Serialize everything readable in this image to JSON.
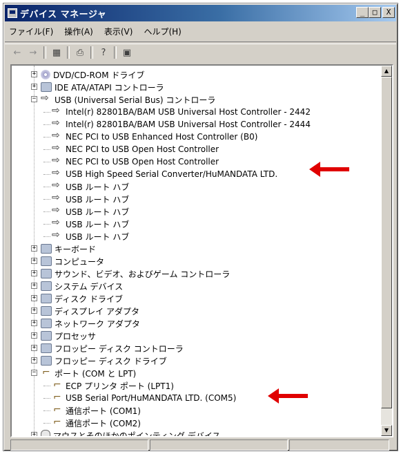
{
  "window": {
    "title": "デバイス マネージャ"
  },
  "window_buttons": {
    "minimize": "_",
    "maximize": "□",
    "close": "X"
  },
  "menu": [
    "ファイル(F)",
    "操作(A)",
    "表示(V)",
    "ヘルプ(H)"
  ],
  "toolbar": {
    "back": "←",
    "forward": "→",
    "view": "▦",
    "print": "⎙",
    "help": "?",
    "properties": "▣"
  },
  "tree": [
    {
      "label": "DVD/CD-ROM ドライブ",
      "level": 1,
      "expander": "+",
      "icon": "dvd-icon"
    },
    {
      "label": "IDE ATA/ATAPI コントローラ",
      "level": 1,
      "expander": "+",
      "icon": "ide-controller-icon"
    },
    {
      "label": "USB (Universal Serial Bus) コントローラ",
      "level": 1,
      "expander": "−",
      "icon": "usb-icon"
    },
    {
      "label": "Intel(r) 82801BA/BAM USB Universal Host Controller - 2442",
      "level": 2,
      "icon": "usb-icon"
    },
    {
      "label": "Intel(r) 82801BA/BAM USB Universal Host Controller - 2444",
      "level": 2,
      "icon": "usb-icon"
    },
    {
      "label": "NEC PCI to USB Enhanced Host Controller (B0)",
      "level": 2,
      "icon": "usb-icon"
    },
    {
      "label": "NEC PCI to USB Open Host Controller",
      "level": 2,
      "icon": "usb-icon"
    },
    {
      "label": "NEC PCI to USB Open Host Controller",
      "level": 2,
      "icon": "usb-icon"
    },
    {
      "label": "USB High Speed Serial Converter/HuMANDATA LTD.",
      "level": 2,
      "icon": "usb-icon"
    },
    {
      "label": "USB ルート ハブ",
      "level": 2,
      "icon": "usb-icon"
    },
    {
      "label": "USB ルート ハブ",
      "level": 2,
      "icon": "usb-icon"
    },
    {
      "label": "USB ルート ハブ",
      "level": 2,
      "icon": "usb-icon"
    },
    {
      "label": "USB ルート ハブ",
      "level": 2,
      "icon": "usb-icon"
    },
    {
      "label": "USB ルート ハブ",
      "level": 2,
      "icon": "usb-icon"
    },
    {
      "label": "キーボード",
      "level": 1,
      "expander": "+",
      "icon": "keyboard-icon"
    },
    {
      "label": "コンピュータ",
      "level": 1,
      "expander": "+",
      "icon": "computer-icon"
    },
    {
      "label": "サウンド、ビデオ、およびゲーム コントローラ",
      "level": 1,
      "expander": "+",
      "icon": "sound-icon"
    },
    {
      "label": "システム デバイス",
      "level": 1,
      "expander": "+",
      "icon": "system-device-icon"
    },
    {
      "label": "ディスク ドライブ",
      "level": 1,
      "expander": "+",
      "icon": "disk-drive-icon"
    },
    {
      "label": "ディスプレイ アダプタ",
      "level": 1,
      "expander": "+",
      "icon": "display-adapter-icon"
    },
    {
      "label": "ネットワーク アダプタ",
      "level": 1,
      "expander": "+",
      "icon": "network-adapter-icon"
    },
    {
      "label": "プロセッサ",
      "level": 1,
      "expander": "+",
      "icon": "processor-icon"
    },
    {
      "label": "フロッピー ディスク コントローラ",
      "level": 1,
      "expander": "+",
      "icon": "floppy-controller-icon"
    },
    {
      "label": "フロッピー ディスク ドライブ",
      "level": 1,
      "expander": "+",
      "icon": "floppy-drive-icon"
    },
    {
      "label": "ポート (COM と LPT)",
      "level": 1,
      "expander": "−",
      "icon": "port-icon"
    },
    {
      "label": "ECP プリンタ ポート (LPT1)",
      "level": 2,
      "icon": "port-icon"
    },
    {
      "label": "USB Serial Port/HuMANDATA LTD. (COM5)",
      "level": 2,
      "icon": "port-icon"
    },
    {
      "label": "通信ポート (COM1)",
      "level": 2,
      "icon": "port-icon"
    },
    {
      "label": "通信ポート (COM2)",
      "level": 2,
      "icon": "port-icon"
    },
    {
      "label": "マウスとそのほかのポインティング デバイス",
      "level": 1,
      "expander": "+",
      "icon": "mouse-icon"
    }
  ],
  "scrollbar": {
    "up": "▲",
    "down": "▼"
  },
  "colors": {
    "title_gradient_start": "#0a246a",
    "title_gradient_end": "#a6caf0",
    "arrow": "#e00000",
    "window_bg": "#d4d0c8"
  }
}
